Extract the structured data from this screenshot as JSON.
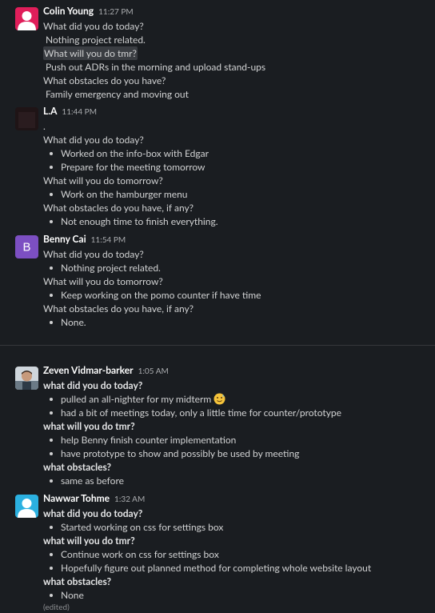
{
  "messages": [
    {
      "author": "Colin Young",
      "time": "11:27 PM",
      "avatar_icon": "default-user-avatar-icon",
      "avatar_color": "#e01e5a",
      "lines": [
        {
          "kind": "text",
          "text": "What did you do today?"
        },
        {
          "kind": "text-indent",
          "text": "Nothing project related."
        },
        {
          "kind": "text-highlight",
          "text": "What will you do tmr?"
        },
        {
          "kind": "text-indent",
          "text": "Push out ADRs in the morning and upload stand-ups"
        },
        {
          "kind": "text",
          "text": "What obstacles do you have?"
        },
        {
          "kind": "text-indent",
          "text": "Family emergency and moving out"
        }
      ]
    },
    {
      "author": "L.A",
      "time": "11:44 PM",
      "avatar_icon": "dark-avatar-icon",
      "avatar_color": "#1f1416",
      "lines": [
        {
          "kind": "text",
          "text": "."
        },
        {
          "kind": "text",
          "text": "What did you do today?"
        },
        {
          "kind": "bullet",
          "text": "Worked on the info-box with Edgar"
        },
        {
          "kind": "bullet",
          "text": "Prepare for the meeting tomorrow"
        },
        {
          "kind": "text",
          "text": "What will you do tomorrow?"
        },
        {
          "kind": "bullet",
          "text": "Work on the hamburger menu"
        },
        {
          "kind": "text",
          "text": "What obstacles do you have, if any?"
        },
        {
          "kind": "bullet",
          "text": "Not enough time to finish everything."
        }
      ]
    },
    {
      "author": "Benny Cai",
      "time": "11:54 PM",
      "avatar_icon": "letter-b-avatar-icon",
      "avatar_letter": "B",
      "avatar_color": "#7c4fc2",
      "lines": [
        {
          "kind": "text",
          "text": "What did you do today?"
        },
        {
          "kind": "bullet",
          "text": "Nothing project related."
        },
        {
          "kind": "text",
          "text": "What will you do tomorrow?"
        },
        {
          "kind": "bullet",
          "text": "Keep working on the pomo counter if have time"
        },
        {
          "kind": "text",
          "text": "What obstacles do you have, if any?"
        },
        {
          "kind": "bullet",
          "text": "None."
        }
      ]
    },
    {
      "author": "Zeven Vidmar-barker",
      "time": "1:05 AM",
      "avatar_icon": "photo-avatar-icon",
      "avatar_color": "#6b7a86",
      "lines": [
        {
          "kind": "bold",
          "text": "what did you do today?"
        },
        {
          "kind": "bullet-emoji",
          "text": "pulled an all-nighter for my midterm",
          "emoji": "sweat-smile-emoji-icon"
        },
        {
          "kind": "bullet",
          "text": "had a bit of meetings today, only a little time for counter/prototype"
        },
        {
          "kind": "bold",
          "text": "what will you do tmr?"
        },
        {
          "kind": "bullet",
          "text": "help Benny finish counter implementation"
        },
        {
          "kind": "bullet",
          "text": "have prototype to show and possibly be used by meeting"
        },
        {
          "kind": "bold",
          "text": "what obstacles?"
        },
        {
          "kind": "bullet",
          "text": "same as before"
        }
      ]
    },
    {
      "author": "Nawwar Tohme",
      "time": "1:32 AM",
      "avatar_icon": "default-user-avatar-icon",
      "avatar_color": "#2bb0e0",
      "edited": "(edited)",
      "lines": [
        {
          "kind": "bold",
          "text": "what did you do today?"
        },
        {
          "kind": "bullet",
          "text": "Started working on css for settings box"
        },
        {
          "kind": "bold",
          "text": "what will you do tmr?"
        },
        {
          "kind": "bullet",
          "text": "Continue work on css for settings box"
        },
        {
          "kind": "bullet",
          "text": "Hopefully figure out planned method for completing whole website layout"
        },
        {
          "kind": "bold",
          "text": "what obstacles?"
        },
        {
          "kind": "bullet",
          "text": "None"
        }
      ]
    }
  ]
}
